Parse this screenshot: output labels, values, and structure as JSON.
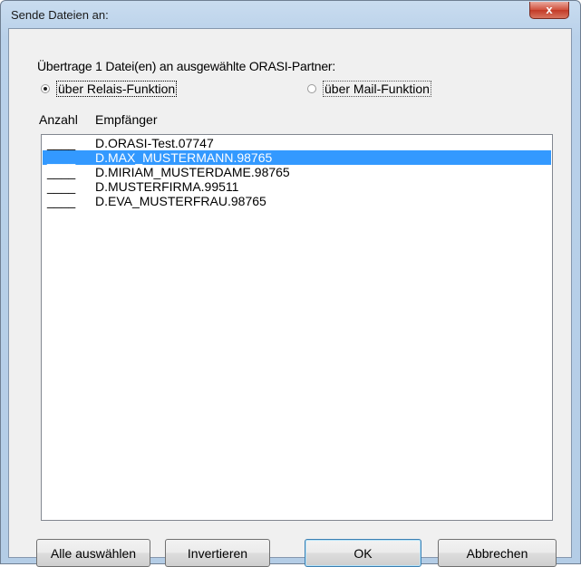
{
  "window": {
    "title": "Sende Dateien an:",
    "close_label": "x"
  },
  "dialog": {
    "heading": "Übertrage 1 Datei(en) an ausgewählte ORASI-Partner:",
    "options": [
      {
        "label": "über Relais-Funktion",
        "selected": true
      },
      {
        "label": "über Mail-Funktion",
        "selected": false
      }
    ],
    "columns": {
      "count": "Anzahl",
      "recipient": "Empfänger"
    },
    "rows": [
      {
        "count": "____",
        "name": "D.ORASI-Test.07747",
        "selected": false
      },
      {
        "count": "____",
        "name": "D.MAX_MUSTERMANN.98765",
        "selected": true
      },
      {
        "count": "____",
        "name": "D.MIRIAM_MUSTERDAME.98765",
        "selected": false
      },
      {
        "count": "____",
        "name": "D.MUSTERFIRMA.99511",
        "selected": false
      },
      {
        "count": "____",
        "name": "D.EVA_MUSTERFRAU.98765",
        "selected": false
      }
    ],
    "buttons": {
      "select_all": "Alle auswählen",
      "invert": "Invertieren",
      "ok": "OK",
      "cancel": "Abbrechen"
    }
  },
  "colors": {
    "selection": "#3399ff",
    "titlebar": "#b9d1ea",
    "close": "#c23a27"
  }
}
